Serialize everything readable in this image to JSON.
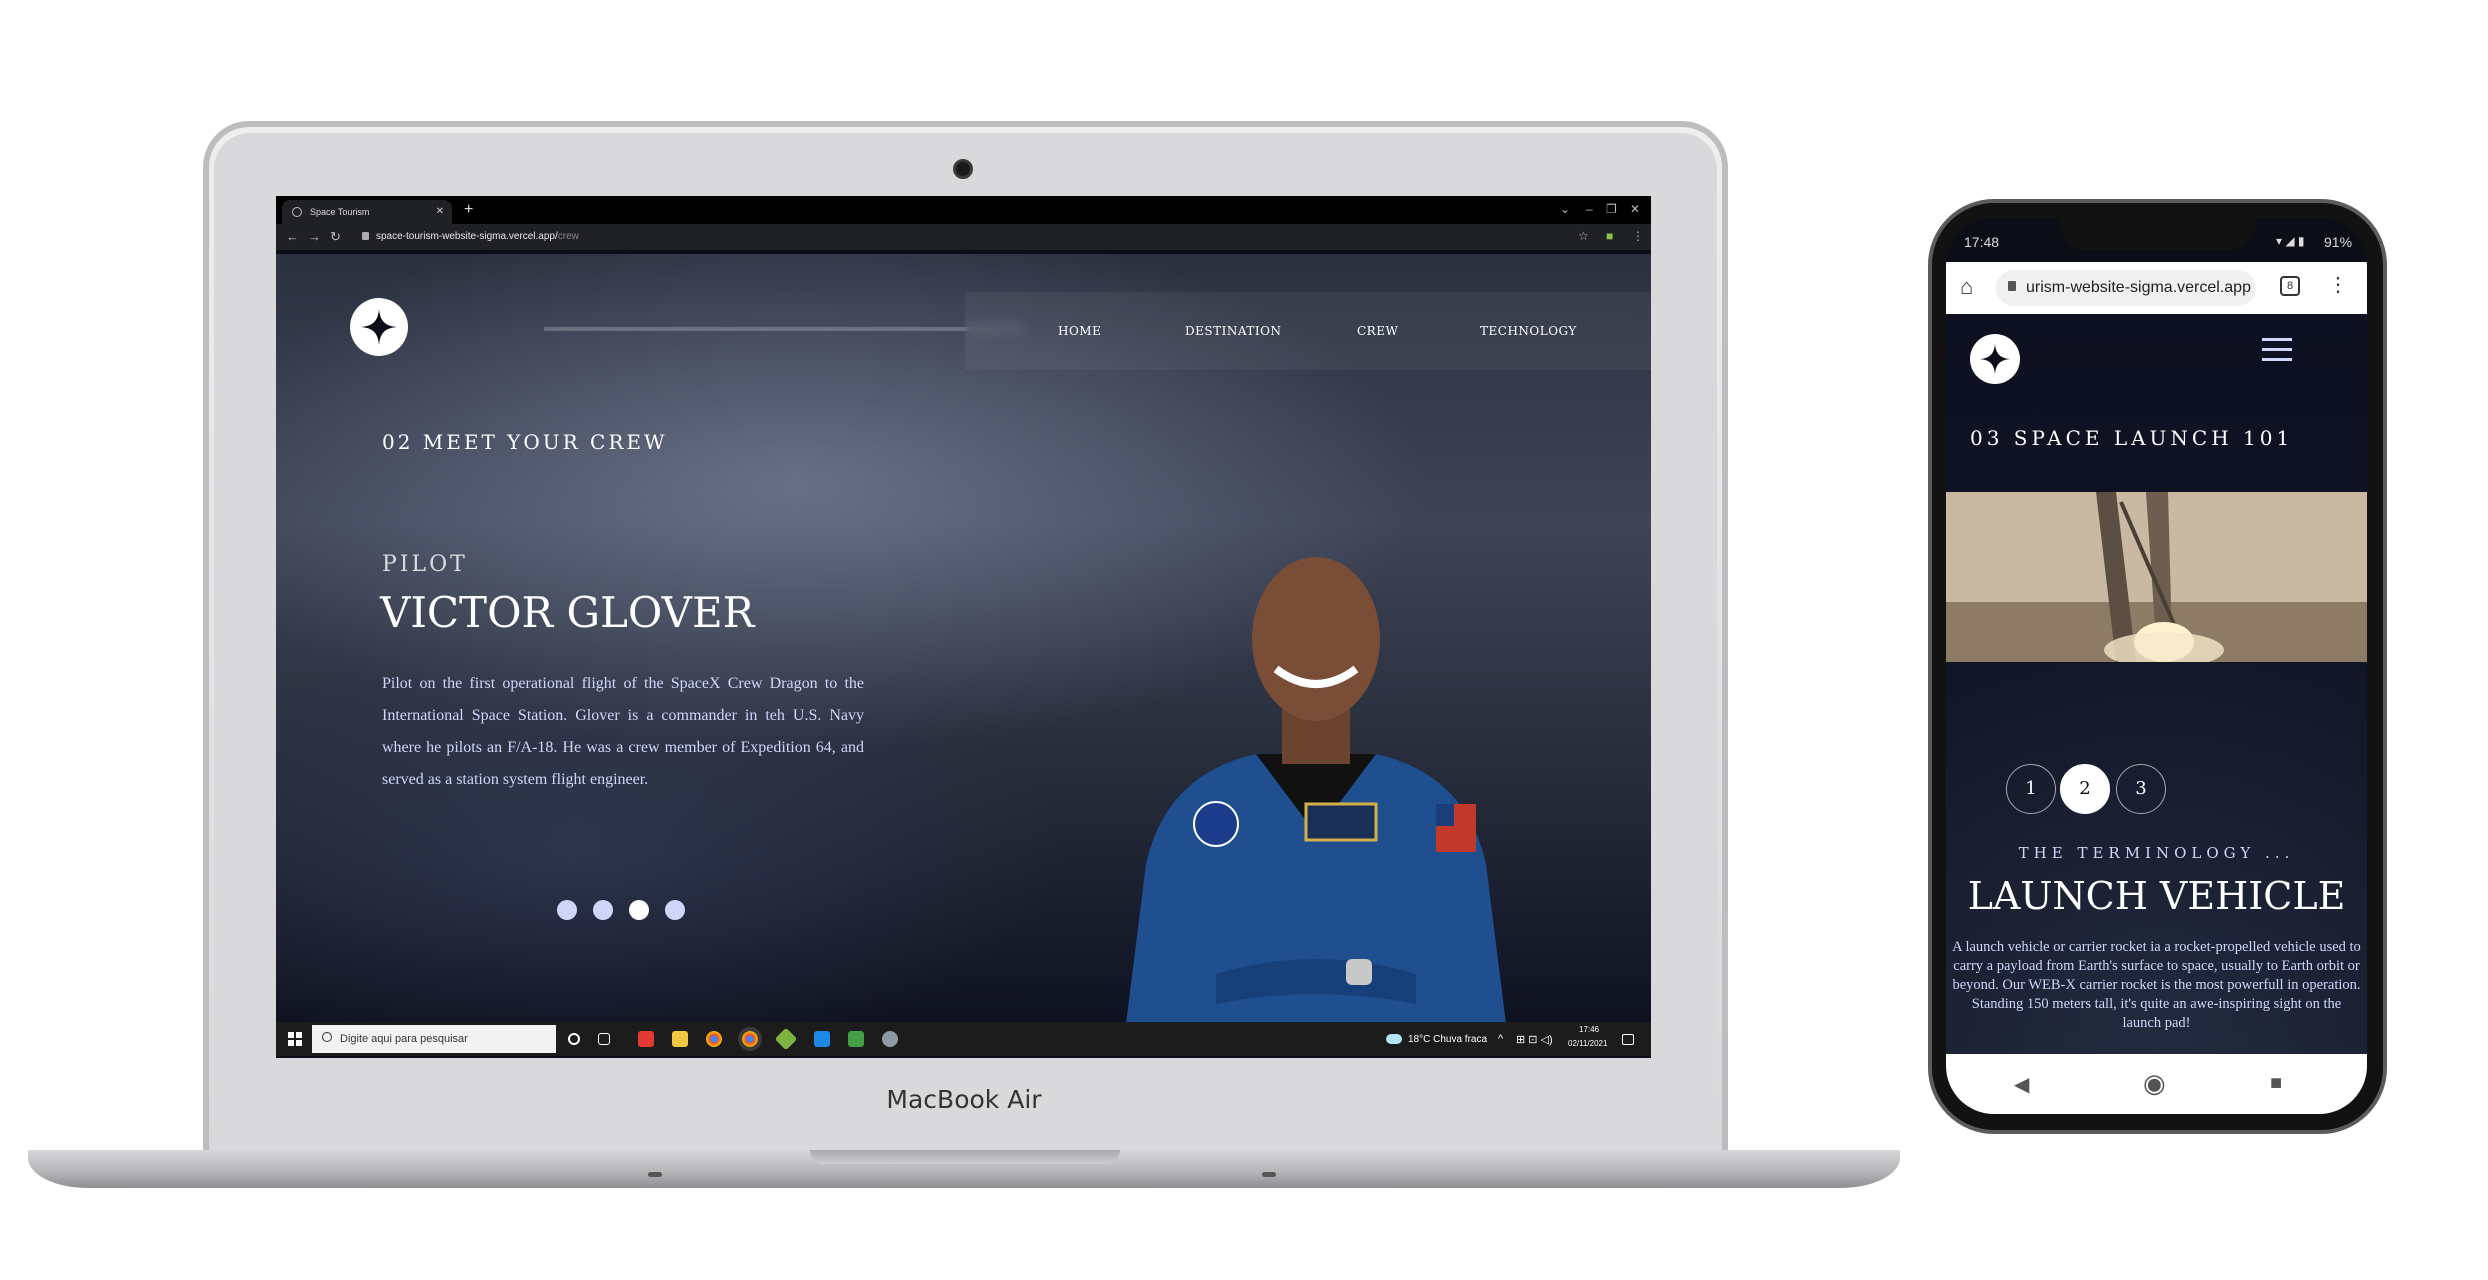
{
  "laptop": {
    "brand": "MacBook Air",
    "browser": {
      "tab_title": "Space Tourism",
      "url_main": "space-tourism-website-sigma.vercel.app/",
      "url_path": "crew"
    },
    "site": {
      "nav": [
        "HOME",
        "DESTINATION",
        "CREW",
        "TECHNOLOGY"
      ],
      "heading": "02 MEET YOUR CREW",
      "role": "PILOT",
      "name": "VICTOR GLOVER",
      "bio": "Pilot on the first operational flight of the SpaceX Crew Dragon to the International Space Station. Glover is a commander in teh U.S. Navy where he pilots an F/A-18. He was a crew member of Expedition 64, and served as a station system flight engineer.",
      "slide_count": 4
    },
    "taskbar": {
      "search_placeholder": "Digite aqui para pesquisar",
      "weather": "18°C  Chuva fraca",
      "time": "17:46",
      "date": "02/11/2021"
    }
  },
  "phone": {
    "status_time": "17:48",
    "battery": "91%",
    "url": "urism-website-sigma.vercel.app",
    "tab_count": "8",
    "site": {
      "heading": "03 SPACE LAUNCH 101",
      "steps": [
        "1",
        "2",
        "3"
      ],
      "active_step": "2",
      "subheading": "THE TERMINOLOGY ...",
      "title": "LAUNCH VEHICLE",
      "body": "A launch vehicle or carrier rocket ia a rocket-propelled vehicle used to carry a payload from Earth's surface to space, usually to Earth orbit or beyond. Our WEB-X carrier rocket is the most powerfull in operation. Standing 150 meters tall, it's quite an awe-inspiring sight on the launch pad!"
    }
  },
  "colors": {
    "space_dark": "#0b0d17",
    "lavender": "#d0d6f9",
    "white": "#ffffff"
  }
}
